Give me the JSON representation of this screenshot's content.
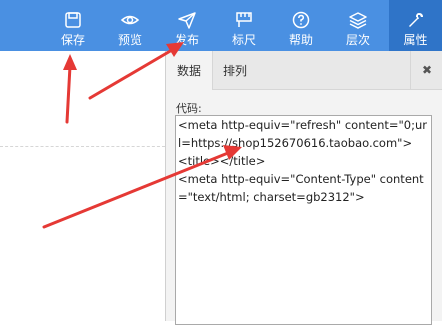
{
  "toolbar": {
    "items": [
      {
        "label": "保存",
        "icon": "save-icon"
      },
      {
        "label": "预览",
        "icon": "eye-icon"
      },
      {
        "label": "发布",
        "icon": "send-icon"
      },
      {
        "label": "标尺",
        "icon": "ruler-icon"
      },
      {
        "label": "帮助",
        "icon": "help-icon"
      },
      {
        "label": "层次",
        "icon": "layers-icon"
      },
      {
        "label": "属性",
        "icon": "wrench-icon",
        "active": true
      }
    ]
  },
  "panel": {
    "tabs": [
      {
        "label": "数据",
        "active": true
      },
      {
        "label": "排列",
        "active": false
      }
    ],
    "close_symbol": "✖",
    "code_label": "代码:",
    "code_value": "<meta http-equiv=\"refresh\" content=\"0;url=https://shop152670616.taobao.com\">\n<title></title>\n<meta http-equiv=\"Content-Type\" content=\"text/html; charset=gb2312\">"
  },
  "colors": {
    "toolbar_bg": "#4a90e2",
    "toolbar_active": "#2f74c8",
    "annotation_arrow": "#e53935"
  }
}
